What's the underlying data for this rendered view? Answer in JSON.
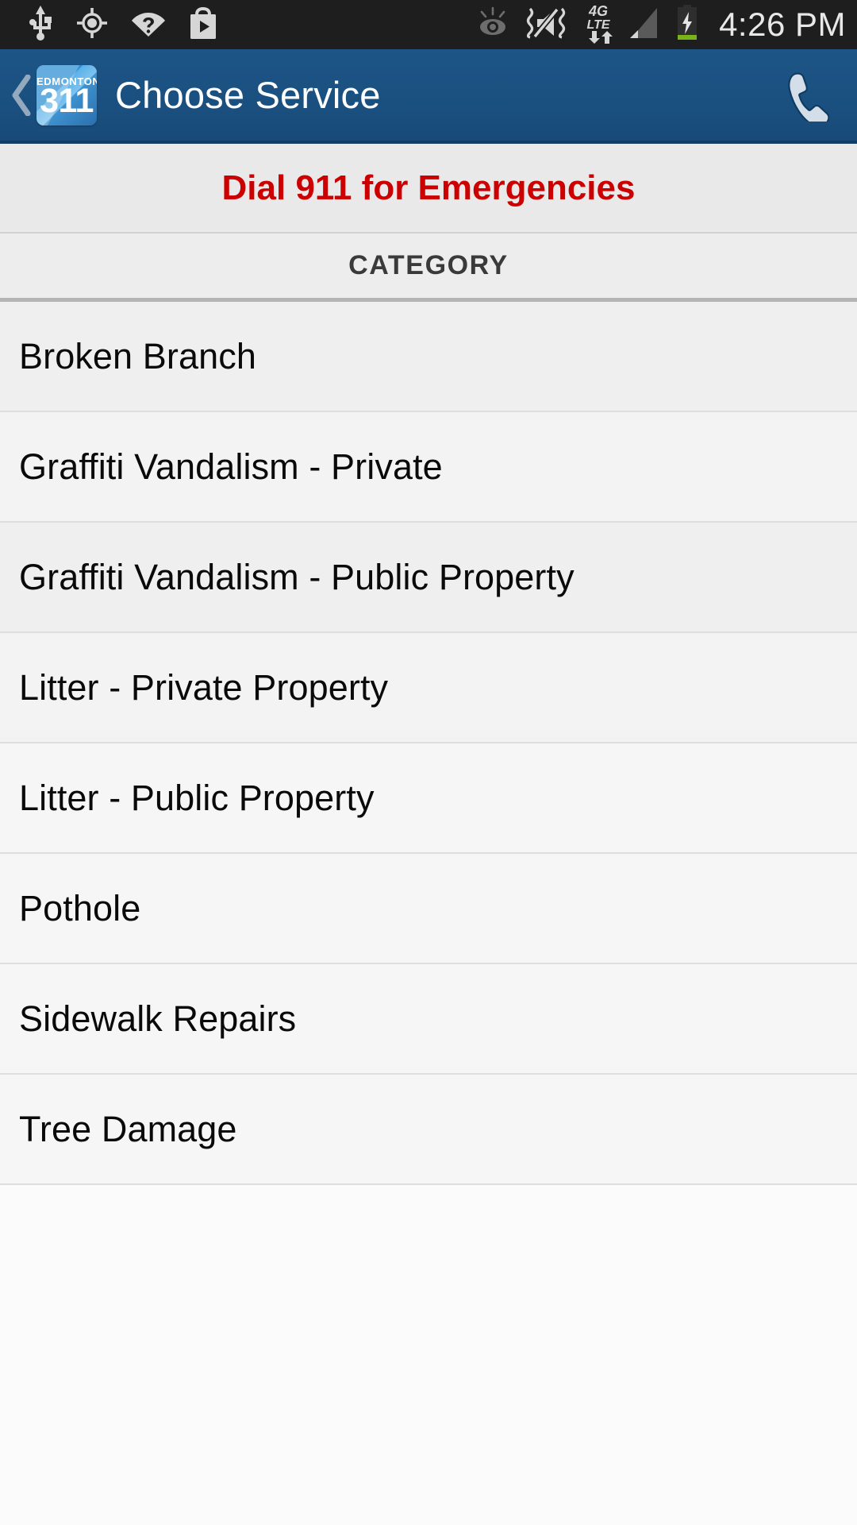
{
  "status_bar": {
    "time": "4:26 PM",
    "left_icons": [
      "usb-icon",
      "gps-location-icon",
      "wifi-question-icon",
      "play-store-icon"
    ],
    "right_icons": [
      "smart-stay-eye-icon",
      "sound-muted-vibrate-icon",
      "4g-lte-data-icon",
      "cell-signal-icon",
      "battery-charging-icon"
    ],
    "network_label_primary": "4G",
    "network_label_secondary": "LTE",
    "background": "#1e1e1e",
    "icon_color": "#d6d6d6"
  },
  "action_bar": {
    "title": "Choose Service",
    "back_label": "Back",
    "call_label": "Call",
    "logo": {
      "top_text": "EDMONTON",
      "number": "311"
    },
    "background": "#1a5080",
    "title_color": "#ffffff"
  },
  "emergency_banner": {
    "text": "Dial 911 for Emergencies",
    "color": "#cc0000",
    "background": "#e9e9e9"
  },
  "section": {
    "header": "CATEGORY",
    "header_color": "#3a3a3a"
  },
  "categories": [
    {
      "label": "Broken Branch"
    },
    {
      "label": "Graffiti Vandalism - Private"
    },
    {
      "label": "Graffiti Vandalism - Public Property"
    },
    {
      "label": "Litter - Private Property"
    },
    {
      "label": "Litter - Public Property"
    },
    {
      "label": "Pothole"
    },
    {
      "label": "Sidewalk Repairs"
    },
    {
      "label": "Tree Damage"
    }
  ]
}
